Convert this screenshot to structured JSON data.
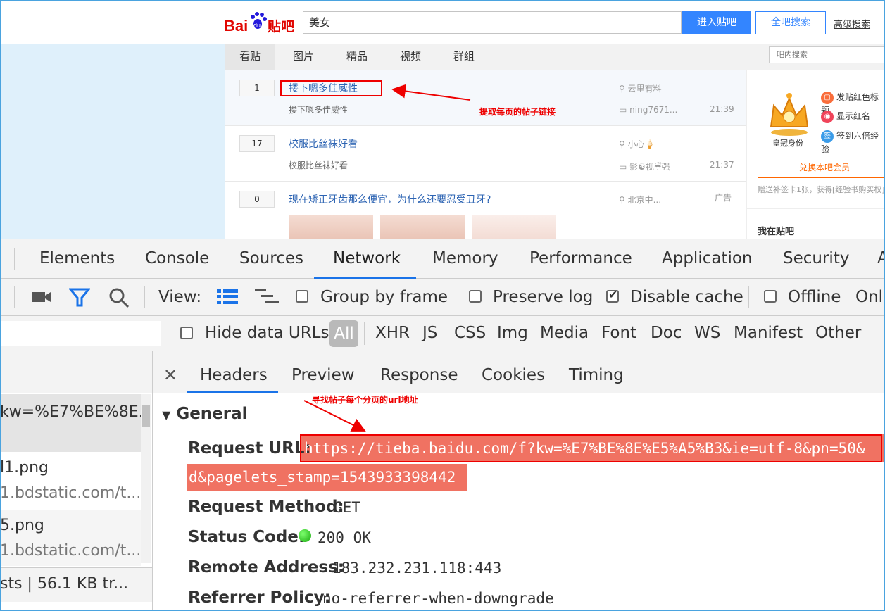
{
  "tieba": {
    "search_value": "美女",
    "enter_button": "进入贴吧",
    "search_all_button": "全吧搜索",
    "advanced_search": "高级搜索",
    "tabs": [
      "看贴",
      "图片",
      "精品",
      "视频",
      "群组"
    ],
    "in_bar_search_placeholder": "吧内搜索",
    "threads": [
      {
        "replies": "1",
        "title": "搂下嗯多佳威性",
        "abstract": "搂下嗯多佳威性",
        "author": "云里有料",
        "last_reply": "ning7671...",
        "time": "21:39"
      },
      {
        "replies": "17",
        "title": "校服比丝袜好看",
        "abstract": "校服比丝袜好看",
        "author": "小心🍦",
        "last_reply": "影☯视☔强",
        "time": "21:37"
      },
      {
        "replies": "0",
        "title": "现在矫正牙齿那么便宜，为什么还要忍受丑牙?",
        "author": "北京中...",
        "ad_label": "广告"
      }
    ],
    "sidebar": {
      "crown_label": "皇冠身份",
      "perks": [
        "发贴红色标题",
        "显示红名",
        "签到六倍经验"
      ],
      "vip_button": "兑换本吧会员",
      "vip_note": "赠送补签卡1张，获得[经验书购买权]",
      "my_tieba": "我在贴吧"
    },
    "annotation_1": "提取每页的帖子链接"
  },
  "devtools": {
    "panels": [
      "Elements",
      "Console",
      "Sources",
      "Network",
      "Memory",
      "Performance",
      "Application",
      "Security",
      "A"
    ],
    "active_panel": "Network",
    "toolbar": {
      "view_label": "View:",
      "group_by_frame": "Group by frame",
      "preserve_log": "Preserve log",
      "disable_cache": "Disable cache",
      "offline": "Offline",
      "online": "Onl"
    },
    "filter": {
      "hide_data_urls": "Hide data URLs",
      "types": [
        "All",
        "XHR",
        "JS",
        "CSS",
        "Img",
        "Media",
        "Font",
        "Doc",
        "WS",
        "Manifest",
        "Other"
      ]
    },
    "requests": [
      {
        "name": "kw=%E7%BE%8E..",
        "sub": ""
      },
      {
        "name": "l1.png",
        "sub": "1.bdstatic.com/t..."
      },
      {
        "name": "5.png",
        "sub": "1.bdstatic.com/t..."
      }
    ],
    "status_bar": "sts  |  56.1 KB tr...",
    "detail_tabs": [
      "Headers",
      "Preview",
      "Response",
      "Cookies",
      "Timing"
    ],
    "general_title": "General",
    "headers": {
      "request_url_label": "Request URL:",
      "request_url_line1": "https://tieba.baidu.com/f?kw=%E7%BE%8E%E5%A5%B3&ie=utf-8&pn=50&",
      "request_url_line2": "d&pagelets_stamp=1543933398442",
      "request_method_label": "Request Method:",
      "request_method": "GET",
      "status_code_label": "Status Code:",
      "status_code": "200 OK",
      "remote_address_label": "Remote Address:",
      "remote_address": "183.232.231.118:443",
      "referrer_policy_label": "Referrer Policy:",
      "referrer_policy": "no-referrer-when-downgrade"
    },
    "annotation_2": "寻找帖子每个分页的url地址"
  }
}
